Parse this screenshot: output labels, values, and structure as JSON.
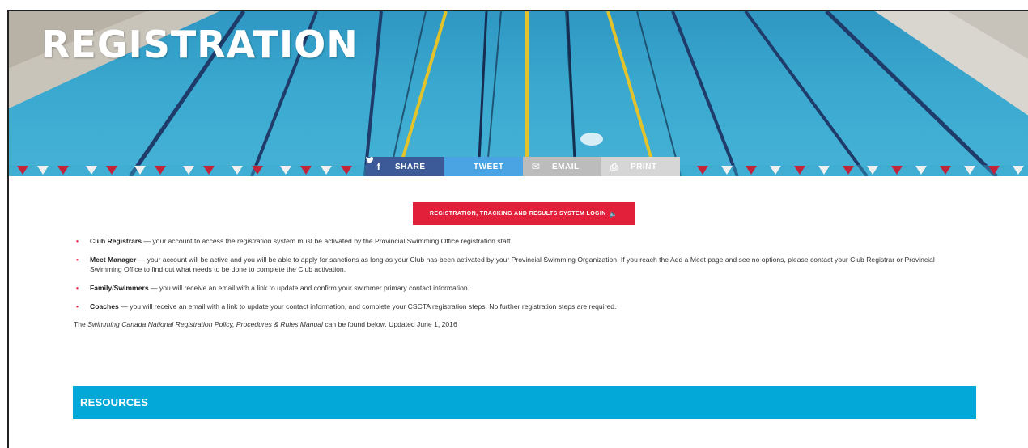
{
  "hero": {
    "title": "REGISTRATION"
  },
  "share_bar": [
    {
      "icon": "facebook-icon",
      "glyph": "f",
      "label": "SHARE"
    },
    {
      "icon": "twitter-icon",
      "glyph": "🐦",
      "label": "TWEET"
    },
    {
      "icon": "mail-icon",
      "glyph": "✉",
      "label": "EMAIL"
    },
    {
      "icon": "printer-icon",
      "glyph": "⎙",
      "label": "PRINT"
    }
  ],
  "login_button": {
    "label": "REGISTRATION, TRACKING AND RESULTS SYSTEM LOGIN",
    "icon": "speaker-icon"
  },
  "bullets": [
    {
      "term": "Club Registrars",
      "text": " — your account to access the registration system must be activated by the Provincial Swimming Office registration staff."
    },
    {
      "term": "Meet Manager",
      "text": " — your account will be active and you will be able to apply for sanctions as long as your Club has been activated by your Provincial Swimming Organization. If you reach the Add a Meet page and see no options, please contact your Club Registrar or Provincial Swimming Office to find out what needs to be done to complete the Club activation."
    },
    {
      "term": "Family/Swimmers",
      "text": " — you will receive an email with a link to update and confirm your swimmer primary contact information."
    },
    {
      "term": "Coaches",
      "text": " — you will receive an email with a link to update your contact information, and complete your CSCTA registration steps. No further registration steps are required."
    }
  ],
  "policy": {
    "prefix": "The ",
    "title": "Swimming Canada National Registration Policy, Procedures & Rules Manual",
    "suffix": " can be found below.  Updated June 1, 2016"
  },
  "resources": {
    "label": "RESOURCES"
  },
  "colors": {
    "accent_red": "#e3203a",
    "resources_blue": "#03a8d9",
    "facebook": "#3c5a98",
    "twitter": "#4aa3e2"
  }
}
